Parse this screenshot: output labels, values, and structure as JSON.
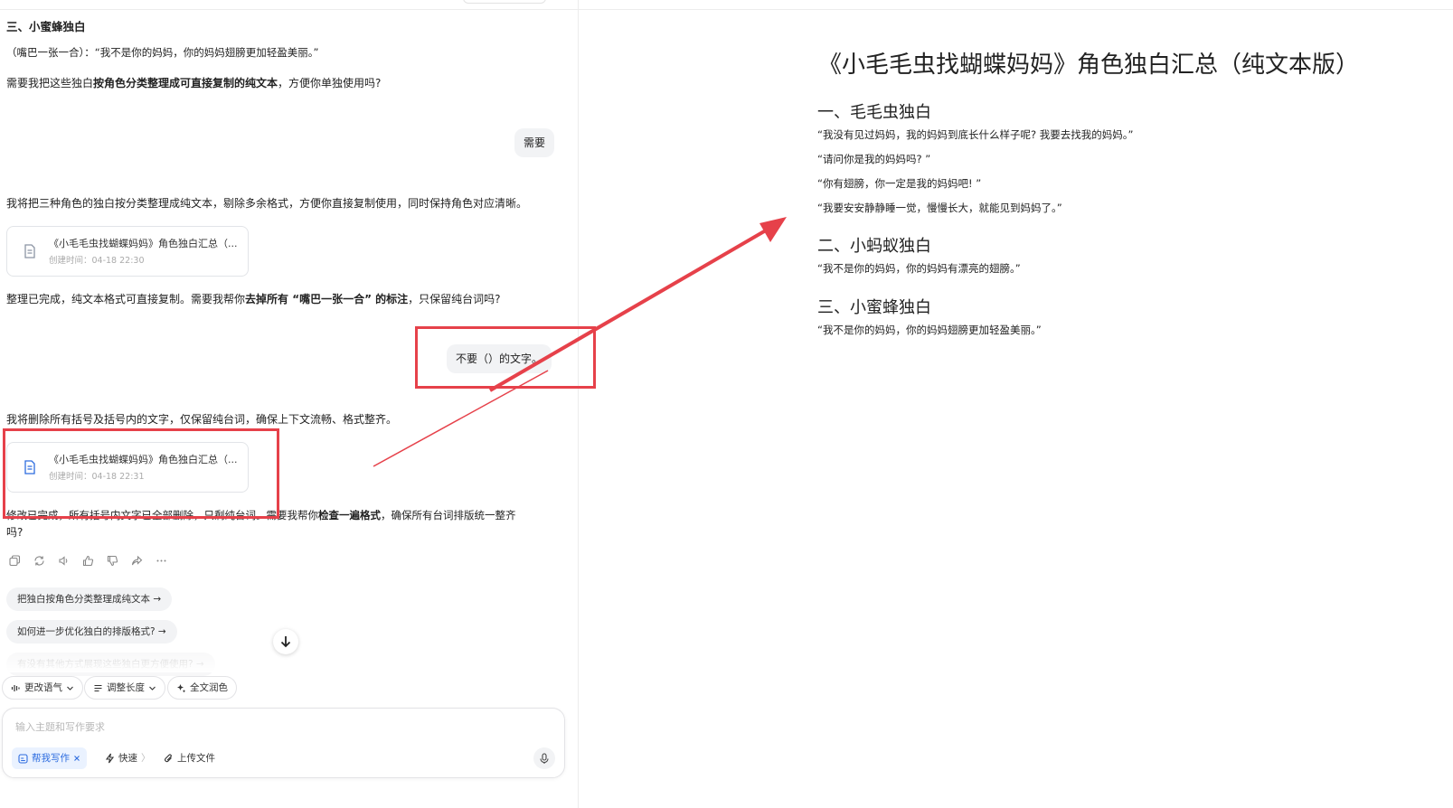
{
  "chat": {
    "section_heading": "三、小蜜蜂独白",
    "bee_line": "（嘴巴一张一合）：“我不是你的妈妈，你的妈妈翅膀更加轻盈美丽。”",
    "question1": {
      "pre": "需要我把这些独白",
      "bold": "按角色分类整理成可直接复制的纯文本",
      "post": "，方便你单独使用吗?"
    },
    "user_reply1": "需要",
    "reply1": "我将把三种角色的独白按分类整理成纯文本，剔除多余格式，方便你直接复制使用，同时保持角色对应清晰。",
    "file1": {
      "title": "《小毛毛虫找蝴蝶妈妈》角色独白汇总（...",
      "time": "创建时间：04-18 22:30"
    },
    "question2": {
      "pre": "整理已完成，纯文本格式可直接复制。需要我帮你",
      "bold": "去掉所有 “嘴巴一张一合” 的标注",
      "post": "，只保留纯台词吗?"
    },
    "user_reply2": "不要（）的文字。",
    "reply2": "我将删除所有括号及括号内的文字，仅保留纯台词，确保上下文流畅、格式整齐。",
    "file2": {
      "title": "《小毛毛虫找蝴蝶妈妈》角色独白汇总（...",
      "time": "创建时间：04-18 22:31"
    },
    "question3": {
      "pre": "修改已完成，所有括号内文字已全部删除，只剩纯台词。需要我帮你",
      "bold": "检查一遍格式",
      "post": "，确保所有台词排版统一整齐",
      "line2": "吗?"
    },
    "actions": [
      "copy-icon",
      "regenerate-icon",
      "speaker-icon",
      "thumbs-up-icon",
      "thumbs-down-icon",
      "share-icon",
      "more-icon"
    ],
    "suggestions": [
      "把独白按角色分类整理成纯文本 →",
      "如何进一步优化独白的排版格式? →",
      "有没有其他方式展现这些独白更方便使用? →"
    ],
    "tools": {
      "tone": "更改语气",
      "length": "调整长度",
      "polish": "全文润色"
    },
    "input": {
      "placeholder": "输入主题和写作要求",
      "help_write": "帮我写作",
      "fast": "快速",
      "upload": "上传文件"
    }
  },
  "document": {
    "title": "《小毛毛虫找蝴蝶妈妈》角色独白汇总（纯文本版）",
    "sections": [
      {
        "heading": "一、毛毛虫独白",
        "lines": [
          "“我没有见过妈妈，我的妈妈到底长什么样子呢? 我要去找我的妈妈。”",
          "“请问你是我的妈妈吗? ”",
          "“你有翅膀，你一定是我的妈妈吧! ”",
          "“我要安安静静睡一觉，慢慢长大，就能见到妈妈了。”"
        ]
      },
      {
        "heading": "二、小蚂蚁独白",
        "lines": [
          "“我不是你的妈妈，你的妈妈有漂亮的翅膀。”"
        ]
      },
      {
        "heading": "三、小蜜蜂独白",
        "lines": [
          "“我不是你的妈妈，你的妈妈翅膀更加轻盈美丽。”"
        ]
      }
    ]
  },
  "colors": {
    "annotation_red": "#e6414a",
    "accent_blue": "#2d6cdf"
  }
}
